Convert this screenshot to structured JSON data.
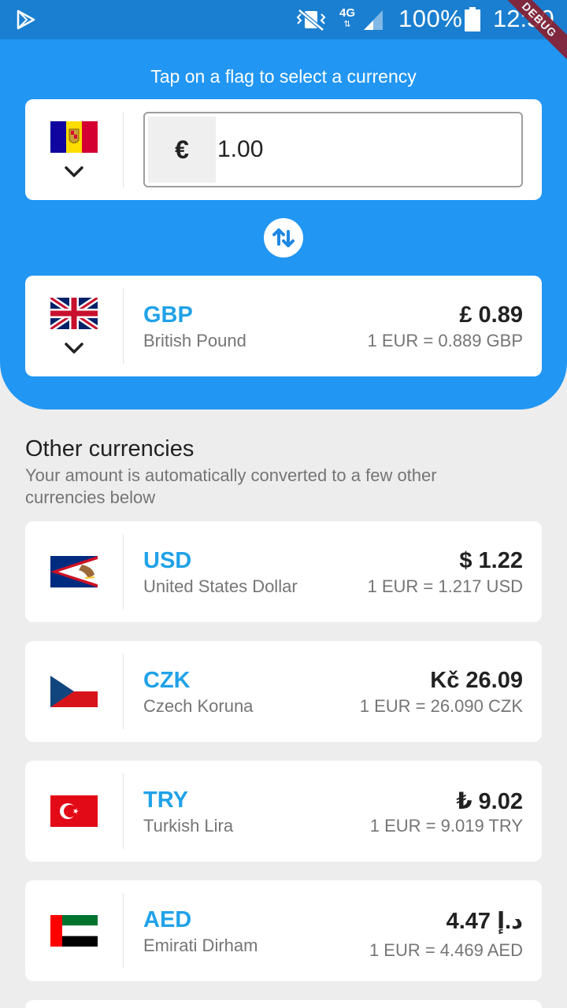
{
  "status_bar": {
    "network": "4G",
    "battery_percent": "100%",
    "time": "12:50",
    "debug_label": "DEBUG",
    "icons": [
      "play-store-icon",
      "mute-vibrate-icon",
      "signal-icon",
      "battery-icon"
    ]
  },
  "header": {
    "hint": "Tap on a flag to select a currency"
  },
  "base": {
    "flag": "andorra",
    "symbol": "€",
    "amount": "1.00"
  },
  "target": {
    "flag": "united-kingdom",
    "code": "GBP",
    "name": "British Pound",
    "amount": "£ 0.89",
    "rate": "1 EUR = 0.889 GBP"
  },
  "other": {
    "title": "Other currencies",
    "subtitle": "Your amount is automatically converted to a few other currencies below",
    "items": [
      {
        "flag": "american-samoa",
        "code": "USD",
        "name": "United States Dollar",
        "amount": "$ 1.22",
        "rate": "1 EUR = 1.217 USD"
      },
      {
        "flag": "czech-republic",
        "code": "CZK",
        "name": "Czech Koruna",
        "amount": "Kč 26.09",
        "rate": "1 EUR = 26.090 CZK"
      },
      {
        "flag": "turkey",
        "code": "TRY",
        "name": "Turkish Lira",
        "amount": "₺ 9.02",
        "rate": "1 EUR = 9.019 TRY"
      },
      {
        "flag": "united-arab-emirates",
        "code": "AED",
        "name": "Emirati Dirham",
        "amount": "د.إ 4.47",
        "rate": "1 EUR = 4.469 AED"
      }
    ]
  },
  "colors": {
    "primary": "#2196f3",
    "status_bar": "#1a7fd0",
    "currency_code": "#20a2e8",
    "background": "#ededed"
  }
}
